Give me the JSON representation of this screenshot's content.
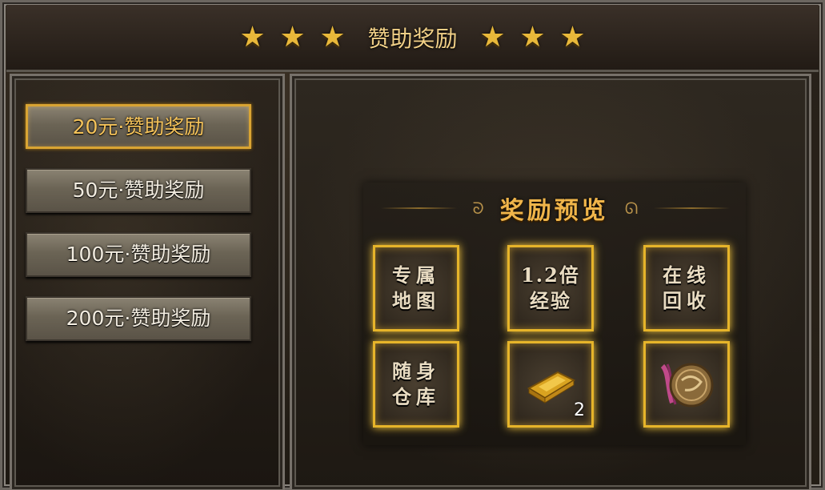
{
  "window": {
    "title": "赞助奖励"
  },
  "tabs": [
    {
      "label": "20元·赞助奖励",
      "active": true
    },
    {
      "label": "50元·赞助奖励",
      "active": false
    },
    {
      "label": "100元·赞助奖励",
      "active": false
    },
    {
      "label": "200元·赞助奖励",
      "active": false
    }
  ],
  "preview": {
    "title": "奖励预览",
    "rewards": [
      {
        "name": "专属地图",
        "icon": "text"
      },
      {
        "name": "1.2倍经验",
        "icon": "text"
      },
      {
        "name": "在线回收",
        "icon": "text"
      },
      {
        "name": "随身仓库",
        "icon": "text"
      },
      {
        "name": "",
        "icon": "gold-ingot-icon",
        "count": "2"
      },
      {
        "name": "",
        "icon": "bronze-medal-icon"
      }
    ]
  },
  "colors": {
    "accent_gold": "#e6b42a",
    "title_text": "#f0cf86",
    "active_tab_text": "#f5c35a"
  }
}
